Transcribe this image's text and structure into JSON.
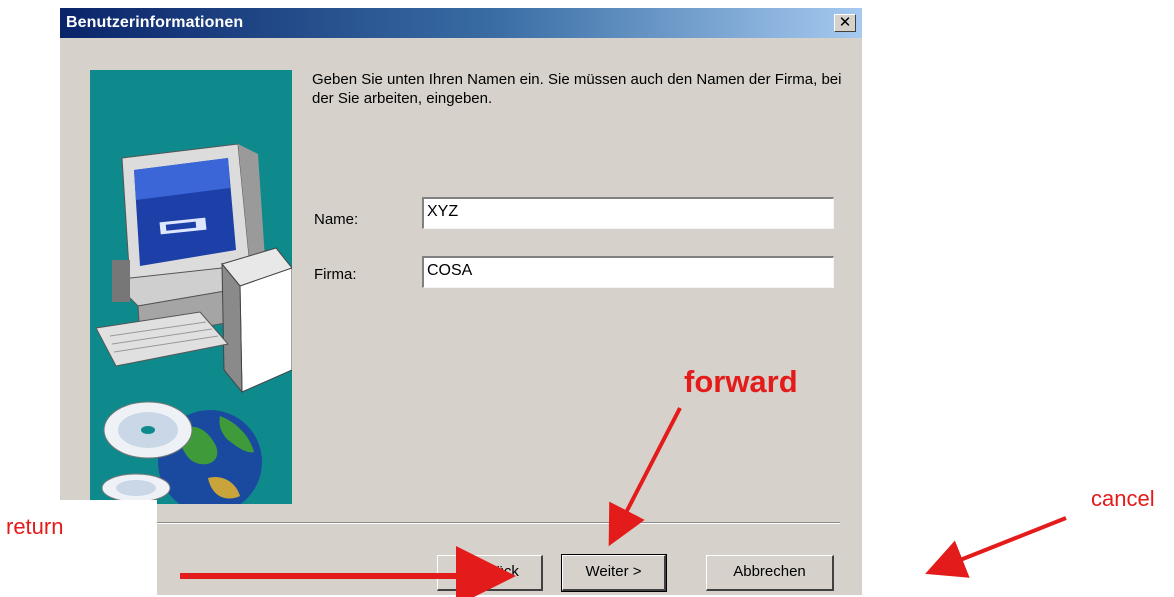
{
  "dialog": {
    "title": "Benutzerinformationen",
    "close_glyph": "✕",
    "intro_text": "Geben Sie unten Ihren Namen ein. Sie müssen auch den Namen der Firma, bei der Sie arbeiten, eingeben.",
    "fields": {
      "name_label": "Name:",
      "name_value": "XYZ",
      "company_label": "Firma:",
      "company_value": "COSA"
    },
    "buttons": {
      "back": "< Zurück",
      "next": "Weiter >",
      "cancel": "Abbrechen"
    }
  },
  "annotations": {
    "forward": "forward",
    "return": "return",
    "cancel": "cancel",
    "color": "#e41b1b"
  },
  "colors": {
    "titlebar_start": "#0a246a",
    "dialog_bg": "#d6d2cb",
    "side_panel": "#0f8a8c"
  }
}
